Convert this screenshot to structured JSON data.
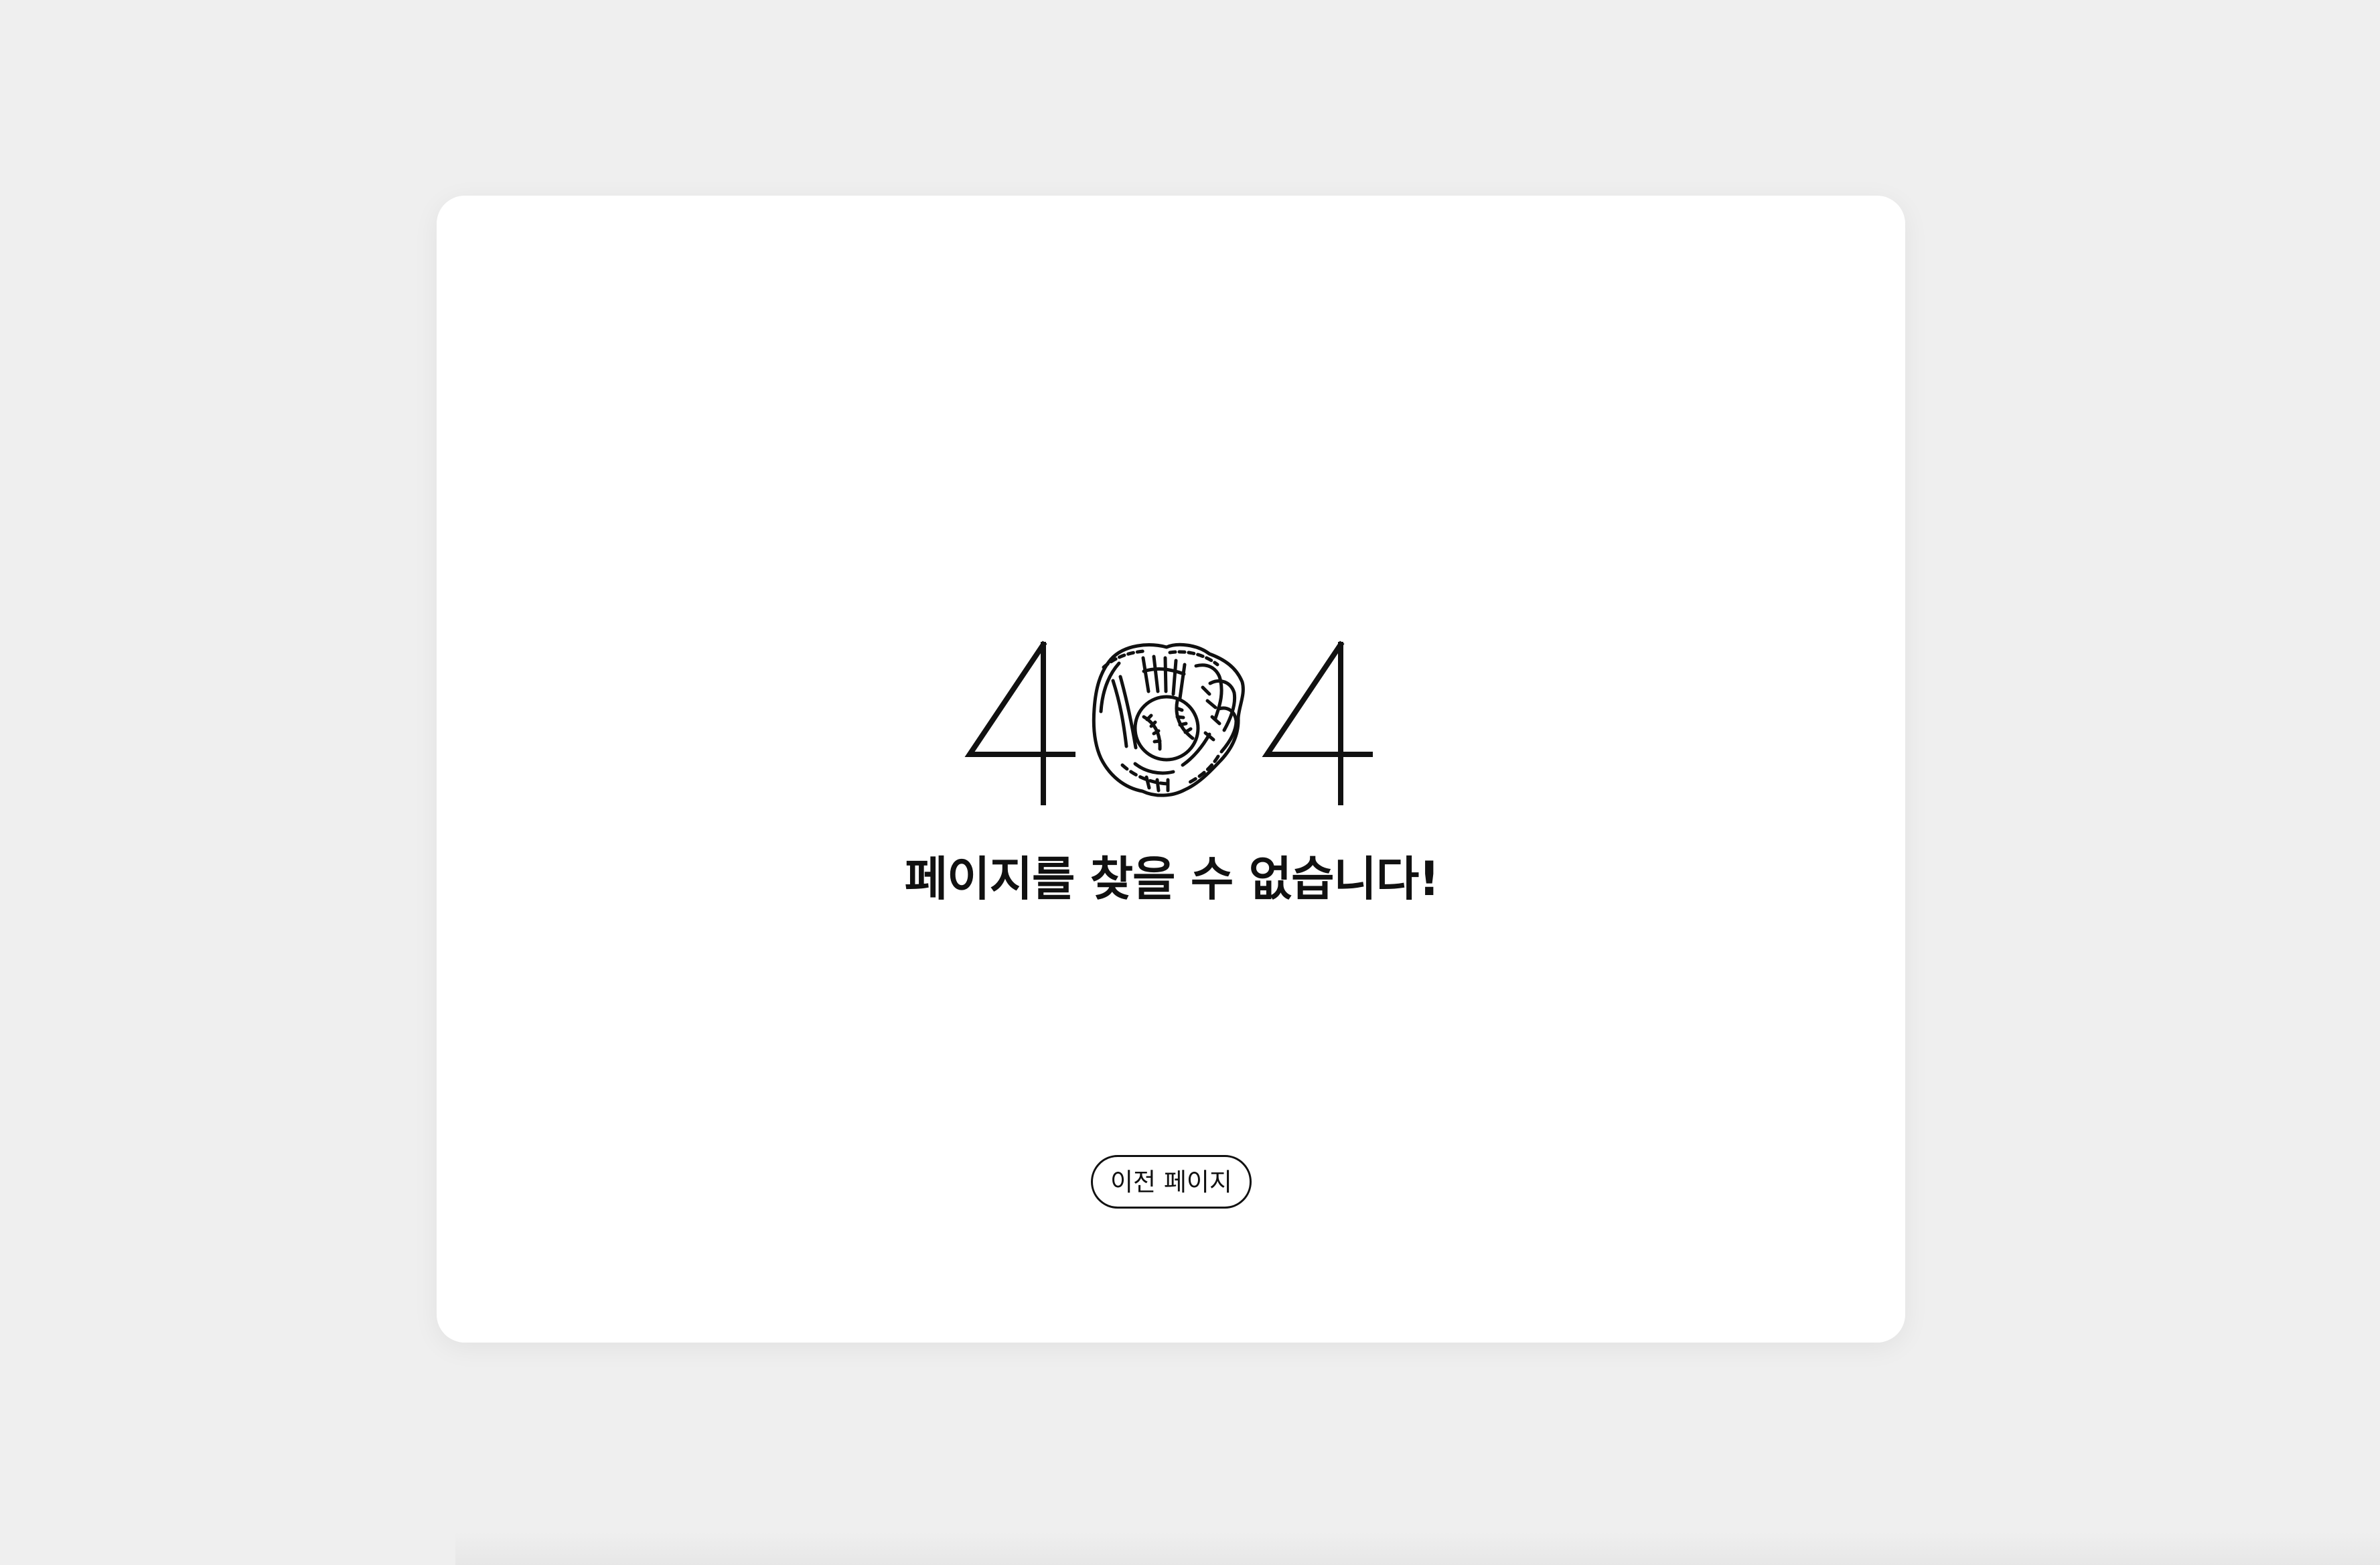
{
  "page": {
    "background_color": "#efefef",
    "card_color": "#ffffff"
  },
  "error": {
    "code_left_digit": "4",
    "code_right_digit": "4",
    "middle_icon": "baseball-glove-icon",
    "message": "페이지를 찾을 수 없습니다!"
  },
  "actions": {
    "back_button_label": "이전 페이지"
  }
}
